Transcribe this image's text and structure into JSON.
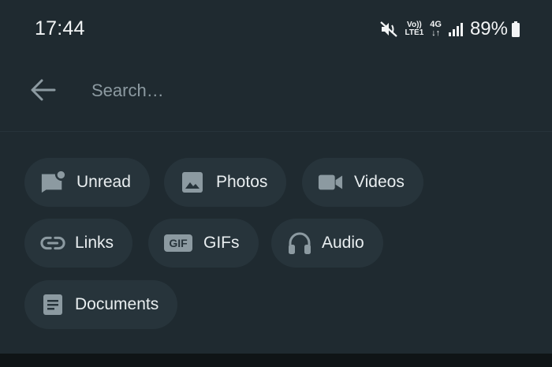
{
  "status_bar": {
    "time": "17:44",
    "volte_top": "Vo))",
    "volte_bottom": "LTE1",
    "network_type": "4G",
    "network_arrows": "↓↑",
    "battery_percent": "89%",
    "icons": [
      "mute-icon",
      "volte-icon",
      "network-4g-icon",
      "signal-icon",
      "battery-icon"
    ]
  },
  "search": {
    "placeholder": "Search…",
    "value": ""
  },
  "filters": [
    {
      "label": "Unread",
      "icon": "unread-chat-icon"
    },
    {
      "label": "Photos",
      "icon": "photo-icon"
    },
    {
      "label": "Videos",
      "icon": "video-icon"
    },
    {
      "label": "Links",
      "icon": "link-icon"
    },
    {
      "label": "GIFs",
      "icon": "gif-icon"
    },
    {
      "label": "Audio",
      "icon": "headphones-icon"
    },
    {
      "label": "Documents",
      "icon": "document-icon"
    }
  ],
  "colors": {
    "background": "#1f2a30",
    "chip": "#27343b",
    "icon": "#8c9aa1",
    "text": "#e9eef0"
  }
}
